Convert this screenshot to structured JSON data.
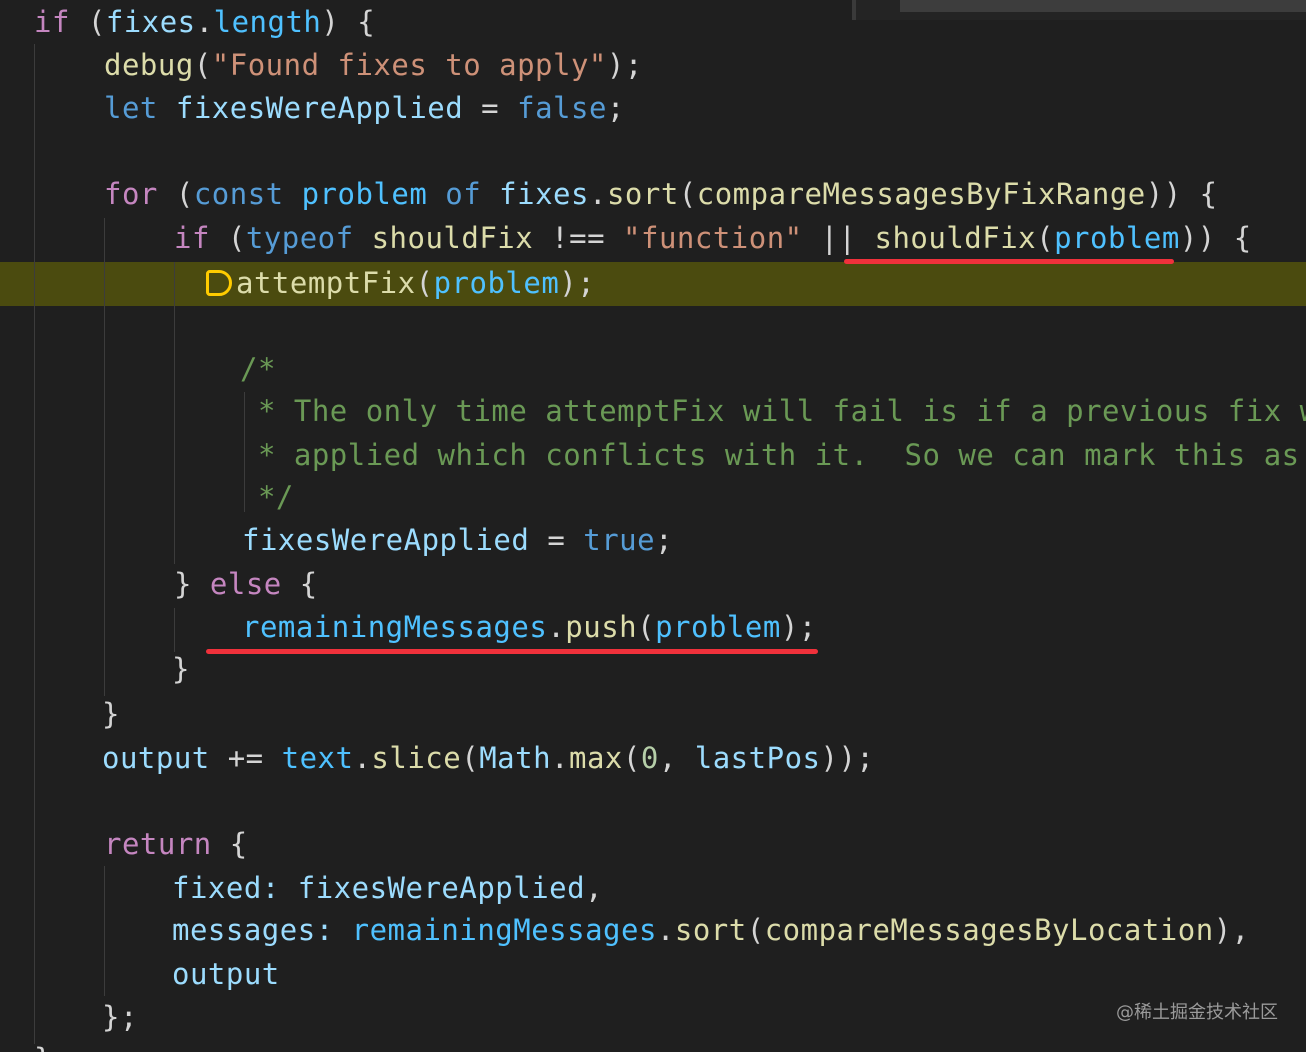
{
  "editor": {
    "theme_colors": {
      "background": "#1f1f1f",
      "current_line": "#4b4b0f",
      "keyword": "#c586c0",
      "storage": "#569cd6",
      "function": "#dcdcaa",
      "string": "#ce9178",
      "variable": "#9cdcfe",
      "comment": "#6a9955",
      "annotation_underline": "#f0313b",
      "breakpoint_outline": "#ffcc00"
    },
    "breakpoint_icon": "debug-stackframe-icon",
    "code": {
      "l1": [
        "if",
        " (",
        "fixes",
        ".",
        "length",
        ") {"
      ],
      "l2": [
        "debug",
        "(",
        "\"Found fixes to apply\"",
        ");"
      ],
      "l3": [
        "let",
        " ",
        "fixesWereApplied",
        " = ",
        "false",
        ";"
      ],
      "l5": [
        "for",
        " (",
        "const",
        " ",
        "problem",
        " ",
        "of",
        " ",
        "fixes",
        ".",
        "sort",
        "(",
        "compareMessagesByFixRange",
        ")) {"
      ],
      "l6": [
        "if",
        " (",
        "typeof",
        " ",
        "shouldFix",
        " !== ",
        "\"function\"",
        " || ",
        "shouldFix",
        "(",
        "problem",
        ")) {"
      ],
      "l7": [
        "attemptFix",
        "(",
        "problem",
        ");"
      ],
      "l9": "/*",
      "l10": " * The only time attemptFix will fail is if a previous fix was",
      "l11": " * applied which conflicts with it.  So we can mark this as tr",
      "l12": " */",
      "l13": [
        "fixesWereApplied",
        " = ",
        "true",
        ";"
      ],
      "l14": [
        "} ",
        "else",
        " {"
      ],
      "l15": [
        "remainingMessages",
        ".",
        "push",
        "(",
        "problem",
        ");"
      ],
      "l16": "}",
      "l17": "}",
      "l18": [
        "output",
        " += ",
        "text",
        ".",
        "slice",
        "(",
        "Math",
        ".",
        "max",
        "(",
        "0",
        ", ",
        "lastPos",
        "));"
      ],
      "l20": [
        "return",
        " {"
      ],
      "l21": [
        "fixed",
        ": ",
        "fixesWereApplied",
        ","
      ],
      "l22": [
        "messages",
        ": ",
        "remainingMessages",
        ".",
        "sort",
        "(",
        "compareMessagesByLocation",
        "),"
      ],
      "l23": "output",
      "l24": "};",
      "l25": "}"
    }
  },
  "watermark": "@稀土掘金技术社区"
}
